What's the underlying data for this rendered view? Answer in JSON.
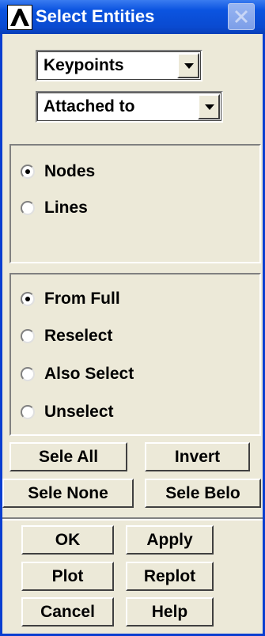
{
  "window": {
    "title": "Select Entities"
  },
  "dropdowns": {
    "entity_type": "Keypoints",
    "criterion": "Attached to"
  },
  "attach_options": [
    {
      "label": "Nodes",
      "checked": true
    },
    {
      "label": "Lines",
      "checked": false
    }
  ],
  "select_modes": [
    {
      "label": "From Full",
      "checked": true
    },
    {
      "label": "Reselect",
      "checked": false
    },
    {
      "label": "Also Select",
      "checked": false
    },
    {
      "label": "Unselect",
      "checked": false
    }
  ],
  "buttons": {
    "sele_all": "Sele All",
    "invert": "Invert",
    "sele_none": "Sele None",
    "sele_belo": "Sele Belo",
    "ok": "OK",
    "apply": "Apply",
    "plot": "Plot",
    "replot": "Replot",
    "cancel": "Cancel",
    "help": "Help"
  },
  "colors": {
    "title_bar": "#0a4ad0",
    "window_face": "#ece9d8",
    "frame_border": "#0a3ed0"
  },
  "icons": {
    "app": "ansys-logo-icon",
    "close": "close-icon",
    "dropdown": "chevron-down-icon"
  }
}
